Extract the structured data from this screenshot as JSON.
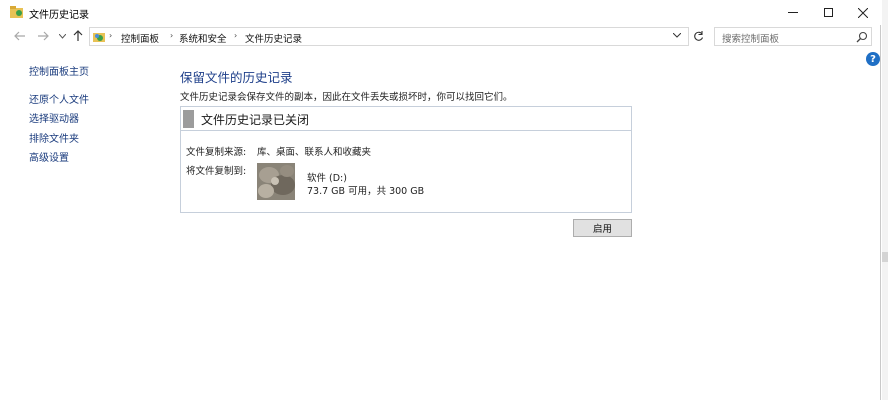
{
  "window": {
    "title": "文件历史记录"
  },
  "navbar": {
    "breadcrumbs": [
      "控制面板",
      "系统和安全",
      "文件历史记录"
    ],
    "search_placeholder": "搜索控制面板"
  },
  "sidebar": {
    "items": [
      {
        "label": "控制面板主页"
      },
      {
        "label": "还原个人文件"
      },
      {
        "label": "选择驱动器"
      },
      {
        "label": "排除文件夹"
      },
      {
        "label": "高级设置"
      }
    ]
  },
  "main": {
    "heading": "保留文件的历史记录",
    "description": "文件历史记录会保存文件的副本，因此在文件丢失或损坏时，你可以找回它们。",
    "status_title": "文件历史记录已关闭",
    "copy_from_label": "文件复制来源:",
    "copy_from_value": "库、桌面、联系人和收藏夹",
    "copy_to_label": "将文件复制到:",
    "drive_name": "软件 (D:)",
    "drive_space": "73.7 GB 可用，共 300 GB",
    "enable_button": "启用"
  },
  "colors": {
    "link": "#1b3c7e",
    "heading": "#1e3f8a",
    "panel_border": "#c6cfdb",
    "status_bar": "#9c9c9c",
    "help_icon": "#1f6fc5"
  },
  "icons": [
    "app-icon",
    "back-arrow-icon",
    "forward-arrow-icon",
    "recent-dropdown-icon",
    "up-arrow-icon",
    "control-panel-icon",
    "address-dropdown-icon",
    "refresh-icon",
    "search-icon",
    "help-icon",
    "drive-thumbnail"
  ]
}
